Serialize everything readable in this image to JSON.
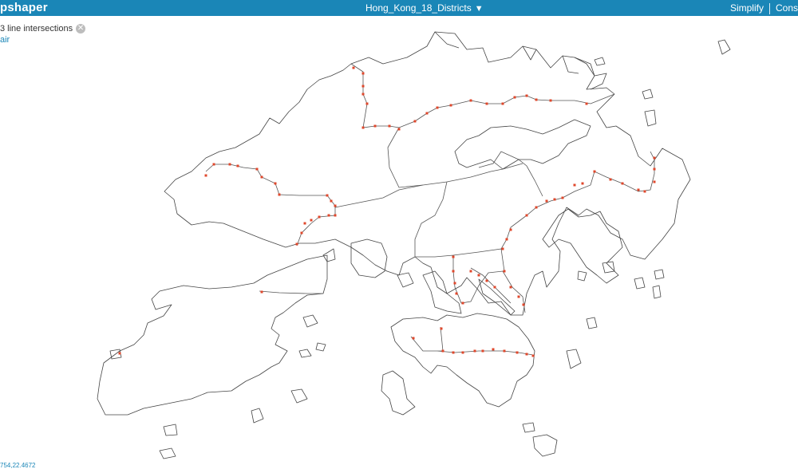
{
  "app": {
    "brand_partial": "pshaper"
  },
  "layer": {
    "name": "Hong_Kong_18_Districts",
    "caret": "▼"
  },
  "menu": {
    "simplify": "Simplify",
    "console_partial": "Cons"
  },
  "status": {
    "intersections_text": "3 line intersections",
    "repair_partial": "air"
  },
  "coords": {
    "partial": "754,22.4672"
  },
  "icons": {
    "close": "close-circle-icon",
    "caret": "caret-down-icon"
  },
  "colors": {
    "topbar": "#1a86b7",
    "intersection_point": "#e0472b",
    "outline": "#444444"
  }
}
